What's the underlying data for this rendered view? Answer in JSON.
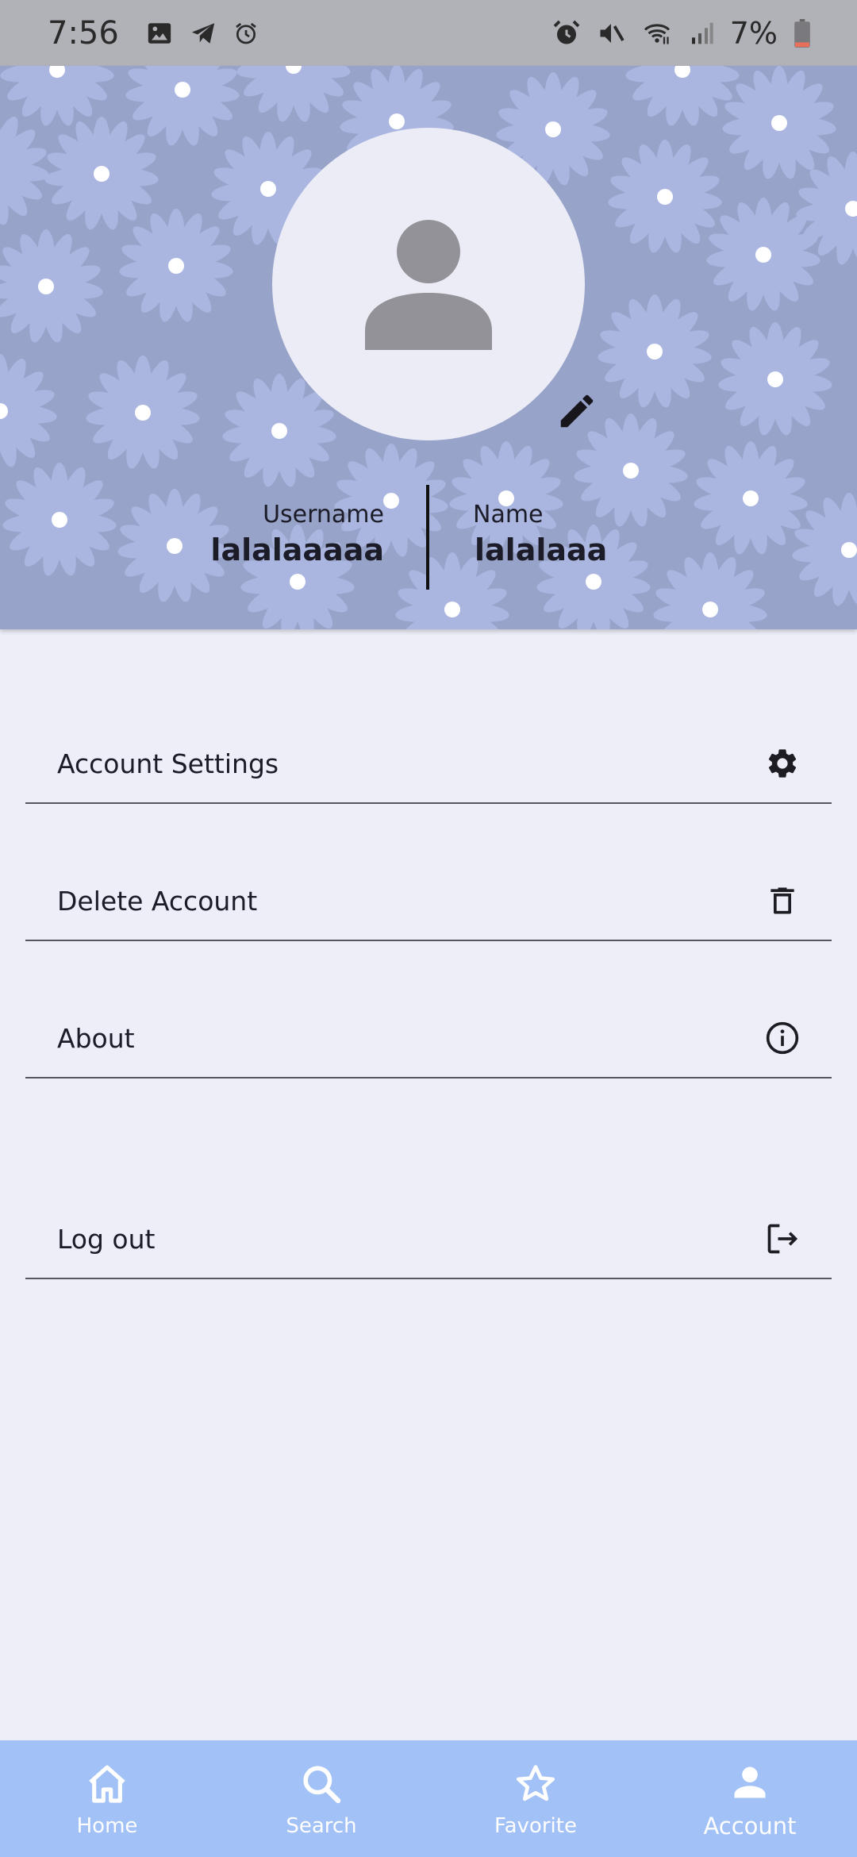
{
  "status_bar": {
    "time": "7:56",
    "battery_percent": "7%",
    "left_icons": [
      "gallery-icon",
      "telegram-icon",
      "alarm-clock-icon"
    ],
    "right_icons": [
      "alarm-icon",
      "mute-icon",
      "wifi-icon",
      "signal-icon",
      "battery-icon"
    ]
  },
  "profile": {
    "username_label": "Username",
    "username": "lalalaaaaa",
    "name_label": "Name",
    "name": "lalalaaa",
    "avatar_icon": "user-placeholder-icon",
    "edit_icon": "pencil-icon"
  },
  "menu": {
    "items": [
      {
        "label": "Account Settings",
        "icon": "gear-icon"
      },
      {
        "label": "Delete Account",
        "icon": "trash-icon"
      },
      {
        "label": "About",
        "icon": "info-icon"
      },
      {
        "label": "Log out",
        "icon": "logout-icon"
      }
    ]
  },
  "bottom_nav": {
    "items": [
      {
        "label": "Home",
        "icon": "home-icon"
      },
      {
        "label": "Search",
        "icon": "search-icon"
      },
      {
        "label": "Favorite",
        "icon": "star-icon"
      },
      {
        "label": "Account",
        "icon": "person-icon",
        "active": true
      }
    ]
  },
  "colors": {
    "header_bg": "#97a3c9",
    "flower": "#aab6e0",
    "page_bg": "#edeef7",
    "nav_bg": "#a2c1f6",
    "status_bar_bg": "#b1b2b8"
  }
}
